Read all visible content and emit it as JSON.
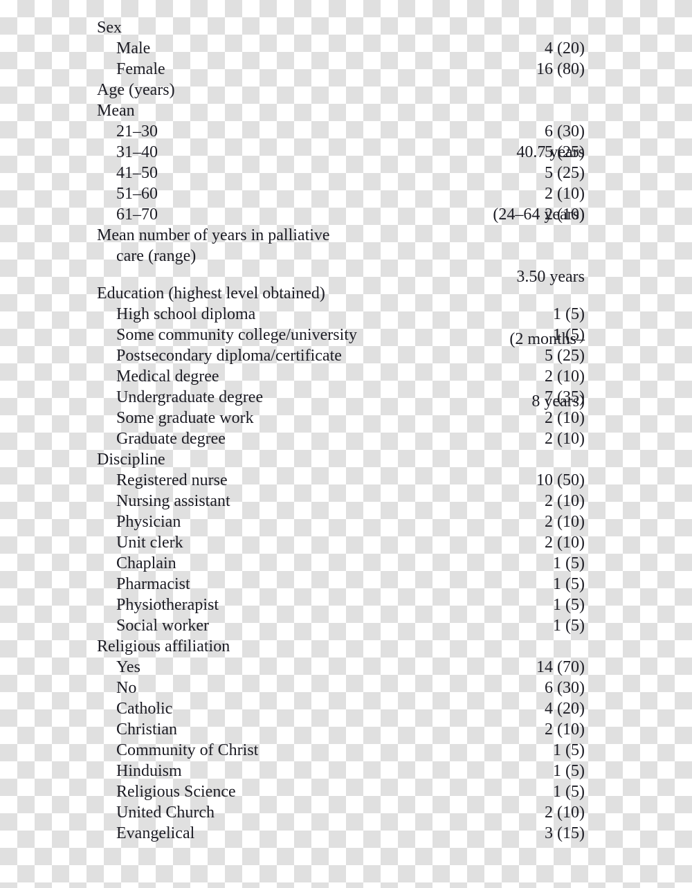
{
  "table": {
    "caption": "",
    "sections": [
      {
        "name": "sex",
        "heading": "Sex",
        "heading_value": "",
        "rows": [
          {
            "name": "male",
            "label": "Male",
            "value": "4 (20)"
          },
          {
            "name": "female",
            "label": "Female",
            "value": "16 (80)"
          }
        ]
      },
      {
        "name": "age-years",
        "heading": "Age (years)",
        "heading_value": "",
        "rows": []
      },
      {
        "name": "age-mean",
        "heading": "Mean",
        "heading_value": "40.7 years",
        "heading_value_line2": "(24–64 years)",
        "rows": [
          {
            "name": "age-21-30",
            "label": "21–30",
            "value": "6 (30)"
          },
          {
            "name": "age-31-40",
            "label": "31–40",
            "value": "5 (25)"
          },
          {
            "name": "age-41-50",
            "label": "41–50",
            "value": "5 (25)"
          },
          {
            "name": "age-51-60",
            "label": "51–60",
            "value": "2 (10)"
          },
          {
            "name": "age-61-70",
            "label": "61–70",
            "value": "2 (10)"
          }
        ]
      },
      {
        "name": "mean-years-palliative-care",
        "heading": "Mean number of years in palliative",
        "heading_cont": "care (range)",
        "heading_value": "3.50 years",
        "heading_value_line2": "(2 months–",
        "heading_value_line3": "8 years)",
        "rows": []
      },
      {
        "name": "education",
        "heading": "Education (highest level obtained)",
        "heading_value": "",
        "rows": [
          {
            "name": "high-school-diploma",
            "label": "High school diploma",
            "value": "1 (5)"
          },
          {
            "name": "some-community-college-university",
            "label": "Some community college/university",
            "value": "1 (5)"
          },
          {
            "name": "postsecondary-diploma-certificate",
            "label": "Postsecondary diploma/certificate",
            "value": "5 (25)"
          },
          {
            "name": "medical-degree",
            "label": "Medical degree",
            "value": "2 (10)"
          },
          {
            "name": "undergraduate-degree",
            "label": "Undergraduate degree",
            "value": "7 (35)"
          },
          {
            "name": "some-graduate-work",
            "label": "Some graduate work",
            "value": "2 (10)"
          },
          {
            "name": "graduate-degree",
            "label": "Graduate degree",
            "value": "2 (10)"
          }
        ]
      },
      {
        "name": "discipline",
        "heading": "Discipline",
        "heading_value": "",
        "rows": [
          {
            "name": "registered-nurse",
            "label": "Registered nurse",
            "value": "10 (50)"
          },
          {
            "name": "nursing-assistant",
            "label": "Nursing assistant",
            "value": "2 (10)"
          },
          {
            "name": "physician",
            "label": "Physician",
            "value": "2 (10)"
          },
          {
            "name": "unit-clerk",
            "label": "Unit clerk",
            "value": "2 (10)"
          },
          {
            "name": "chaplain",
            "label": "Chaplain",
            "value": "1 (5)"
          },
          {
            "name": "pharmacist",
            "label": "Pharmacist",
            "value": "1 (5)"
          },
          {
            "name": "physiotherapist",
            "label": "Physiotherapist",
            "value": "1 (5)"
          },
          {
            "name": "social-worker",
            "label": "Social worker",
            "value": "1 (5)"
          }
        ]
      },
      {
        "name": "religious-affiliation",
        "heading": "Religious affiliation",
        "heading_value": "",
        "rows": [
          {
            "name": "religious-yes",
            "label": "Yes",
            "value": "14 (70)"
          },
          {
            "name": "religious-no",
            "label": "No",
            "value": "6 (30)"
          },
          {
            "name": "catholic",
            "label": "Catholic",
            "value": "4 (20)"
          },
          {
            "name": "christian",
            "label": "Christian",
            "value": "2 (10)"
          },
          {
            "name": "community-of-christ",
            "label": "Community of Christ",
            "value": "1 (5)"
          },
          {
            "name": "hinduism",
            "label": "Hinduism",
            "value": "1 (5)"
          },
          {
            "name": "religious-science",
            "label": "Religious Science",
            "value": "1 (5)"
          },
          {
            "name": "united-church",
            "label": "United Church",
            "value": "2 (10)"
          },
          {
            "name": "evangelical",
            "label": "Evangelical",
            "value": "3 (15)"
          }
        ]
      }
    ]
  },
  "style": {
    "text_color": "#1c1c24",
    "checker_light": "#ffffff",
    "checker_dark": "#e0e0e0"
  }
}
